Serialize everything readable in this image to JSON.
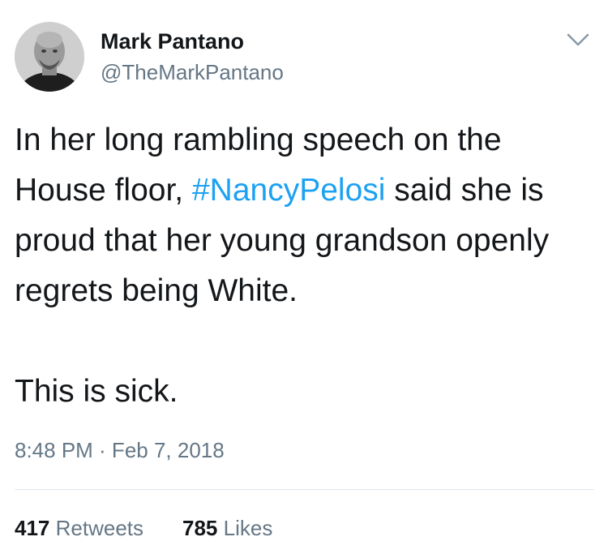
{
  "author": {
    "display_name": "Mark Pantano",
    "handle": "@TheMarkPantano"
  },
  "tweet": {
    "text_part1": "In her long rambling speech on the House floor, ",
    "hashtag": "#NancyPelosi",
    "text_part2": " said she is proud that her young grandson openly regrets being White.",
    "text_part3": "This is sick.",
    "timestamp": "8:48 PM · Feb 7, 2018"
  },
  "stats": {
    "retweets_count": "417",
    "retweets_label": "Retweets",
    "likes_count": "785",
    "likes_label": "Likes"
  },
  "colors": {
    "link": "#1da1f2",
    "secondary_text": "#657786",
    "primary_text": "#14171a"
  },
  "icons": {
    "menu": "chevron-down-icon"
  }
}
